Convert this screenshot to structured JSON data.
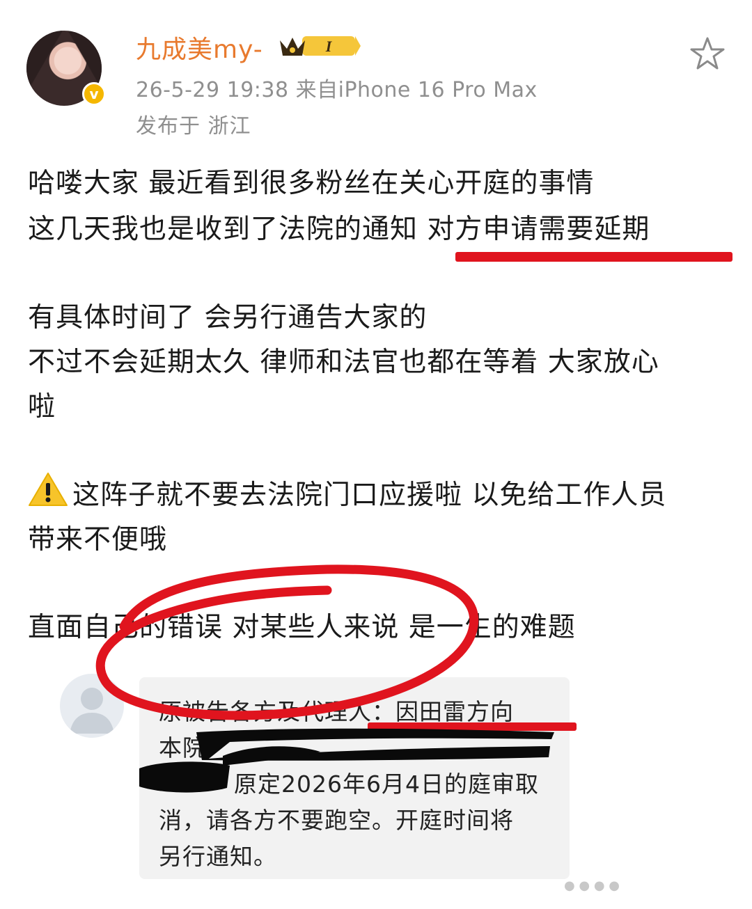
{
  "post": {
    "username": "九成美my-",
    "level_badge": "I",
    "timestamp_source": "26-5-29 19:38  来自iPhone 16 Pro Max",
    "location": "发布于 浙江",
    "lines": [
      "哈喽大家 最近看到很多粉丝在关心开庭的事情",
      "这几天我也是收到了法院的通知 对方申请需要延期",
      "有具体时间了 会另行通告大家的",
      "不过不会延期太久 律师和法官也都在等着 大家放心",
      "啦",
      "这阵子就不要去法院门口应援啦 以免给工作人员",
      "带来不便哦",
      "直面自己的错误 对某些人来说 是一生的难题"
    ]
  },
  "comment": {
    "faded_line": "",
    "lines": [
      "原被告各方及代理人：因田雷方向",
      "本院",
      "原定2026年6月4日的庭审取",
      "消，请各方不要跑空。开庭时间将",
      "另行通知。"
    ]
  },
  "icons": {
    "star": "star-outline-icon",
    "verified": "verified-badge-icon",
    "warning": "warning-icon",
    "crown": "crown-level-icon"
  },
  "colors": {
    "username": "#e87a2e",
    "meta": "#8f8f8f",
    "underline": "#e0141e",
    "circle": "#e0141e",
    "redaction": "#0a0a0a",
    "card_bg": "#f2f2f2"
  }
}
